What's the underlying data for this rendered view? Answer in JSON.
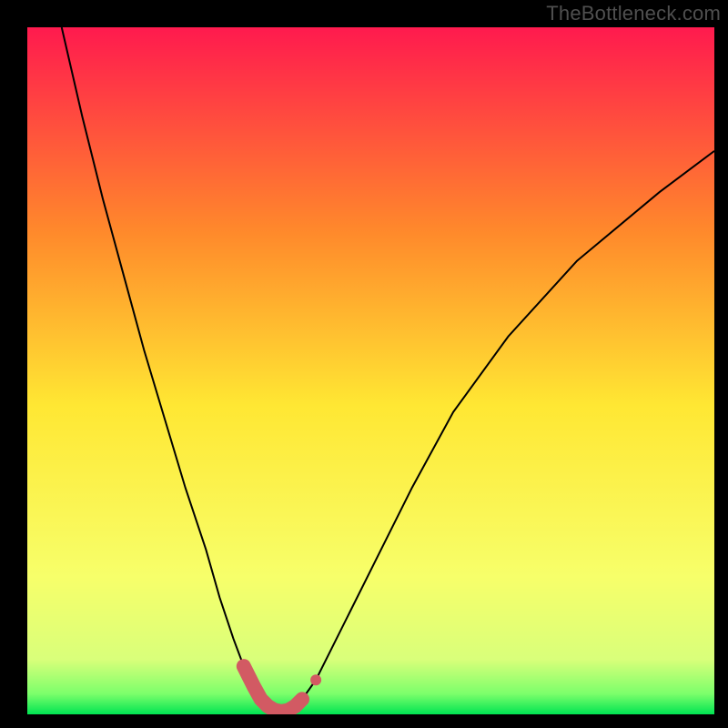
{
  "watermark": "TheBottleneck.com",
  "chart_data": {
    "type": "line",
    "title": "",
    "xlabel": "",
    "ylabel": "",
    "xlim": [
      0,
      100
    ],
    "ylim": [
      0,
      100
    ],
    "grid": false,
    "legend": false,
    "background_gradient": {
      "top": "#ff1a4e",
      "mid_upper": "#ff8a2b",
      "mid": "#ffe733",
      "mid_lower": "#f7ff6a",
      "band": "#d9ff7a",
      "bottom_band": "#7cff6b",
      "bottom": "#00e452"
    },
    "series": [
      {
        "name": "bottleneck-curve",
        "color": "#000000",
        "stroke_width": 2,
        "x": [
          5,
          8,
          11,
          14,
          17,
          20,
          23,
          26,
          28,
          30,
          31.5,
          33,
          34,
          35,
          36,
          37,
          38,
          39,
          40,
          42,
          44,
          47,
          51,
          56,
          62,
          70,
          80,
          92,
          100
        ],
        "y": [
          100,
          87,
          75,
          64,
          53,
          43,
          33,
          24,
          17,
          11,
          7,
          4,
          2.2,
          1.2,
          0.6,
          0.4,
          0.6,
          1.2,
          2.2,
          5,
          9,
          15,
          23,
          33,
          44,
          55,
          66,
          76,
          82
        ]
      },
      {
        "name": "optimal-range-marker",
        "color": "#d25a63",
        "type": "marker-band",
        "x": [
          31.5,
          33,
          34,
          35,
          36,
          37,
          38,
          39,
          40
        ],
        "y": [
          7,
          4,
          2.2,
          1.2,
          0.6,
          0.4,
          0.6,
          1.2,
          2.2
        ],
        "dot": {
          "x": 42,
          "y": 5,
          "r": 6
        }
      }
    ]
  }
}
